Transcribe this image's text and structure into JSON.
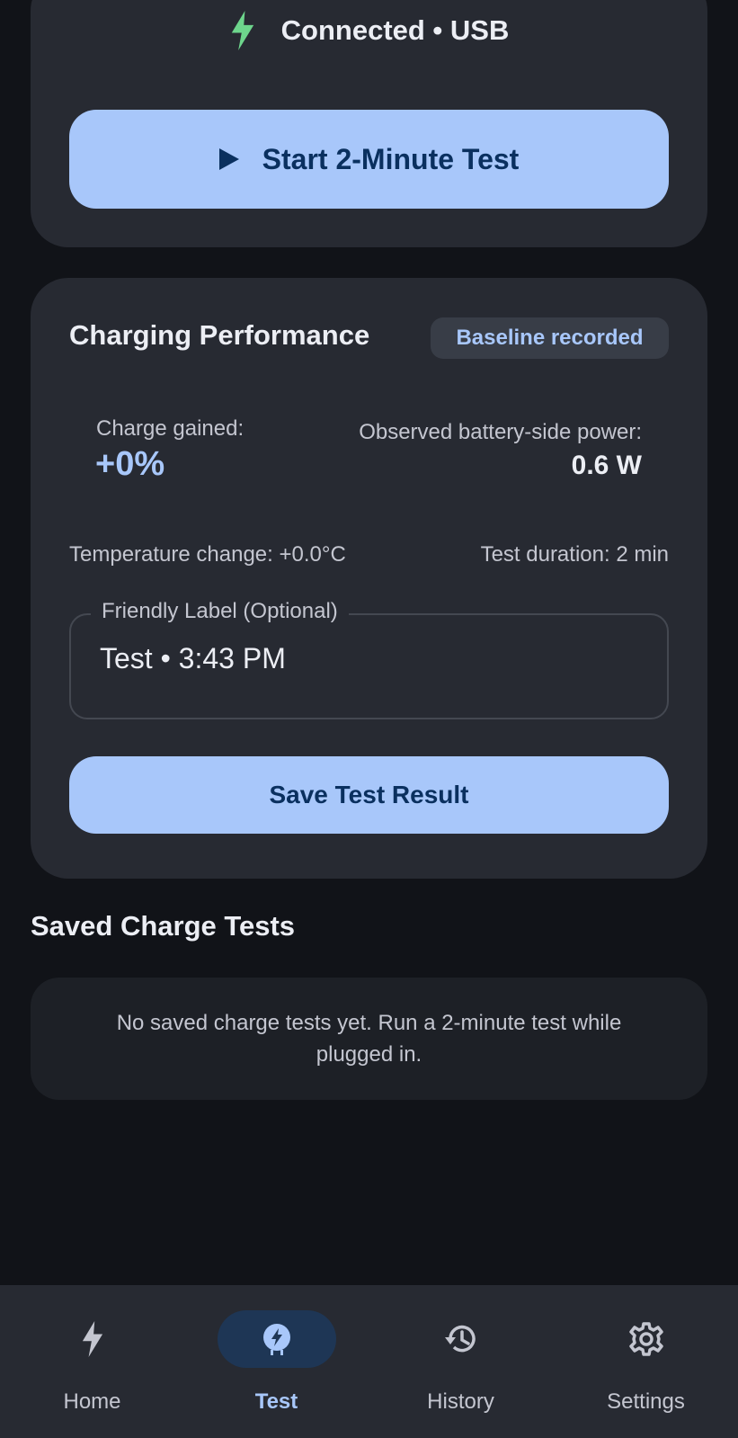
{
  "connection": {
    "status_text": "Connected • USB",
    "icon": "bolt-icon",
    "icon_color": "#6dd58c"
  },
  "start_button": {
    "label": "Start 2-Minute Test",
    "icon": "play-icon"
  },
  "performance": {
    "title": "Charging Performance",
    "badge": "Baseline recorded",
    "charge_gained_label": "Charge gained:",
    "charge_gained_value": "+0%",
    "power_label": "Observed battery-side power:",
    "power_value": "0.6 W",
    "temperature_change": "Temperature change: +0.0°C",
    "test_duration": "Test duration: 2 min",
    "friendly_label": {
      "label": "Friendly Label (Optional)",
      "value": "Test • 3:43 PM"
    },
    "save_label": "Save Test Result"
  },
  "saved_tests": {
    "title": "Saved Charge Tests",
    "empty_message": "No saved charge tests yet. Run a 2-minute test while plugged in."
  },
  "nav": {
    "active": "Test",
    "items": [
      {
        "label": "Home",
        "icon": "bolt-icon"
      },
      {
        "label": "Test",
        "icon": "charge-test-icon"
      },
      {
        "label": "History",
        "icon": "history-icon"
      },
      {
        "label": "Settings",
        "icon": "gear-icon"
      }
    ]
  },
  "colors": {
    "background": "#111318",
    "card": "#272a32",
    "primary": "#a8c7fa",
    "on_primary": "#0a305f",
    "accent_green": "#6dd58c"
  }
}
